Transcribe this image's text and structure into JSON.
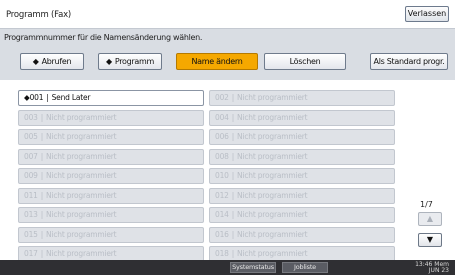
{
  "window": {
    "title": "Programm (Fax)",
    "exit_label": "Verlassen"
  },
  "instruction": "Programmnummer für die Namensänderung wählen.",
  "toolbar": {
    "recall_label": "Abrufen",
    "recall_icon": "◆",
    "program_label": "Programm",
    "program_icon": "◆",
    "rename_label": "Name ändern",
    "delete_label": "Löschen",
    "default_label": "Als Standard progr."
  },
  "slots_left": [
    {
      "num": "001",
      "label": "Send Later",
      "filled": true
    },
    {
      "num": "003",
      "label": "Nicht programmiert",
      "filled": false
    },
    {
      "num": "005",
      "label": "Nicht programmiert",
      "filled": false
    },
    {
      "num": "007",
      "label": "Nicht programmiert",
      "filled": false
    },
    {
      "num": "009",
      "label": "Nicht programmiert",
      "filled": false
    },
    {
      "num": "011",
      "label": "Nicht programmiert",
      "filled": false
    },
    {
      "num": "013",
      "label": "Nicht programmiert",
      "filled": false
    },
    {
      "num": "015",
      "label": "Nicht programmiert",
      "filled": false
    },
    {
      "num": "017",
      "label": "Nicht programmiert",
      "filled": false
    }
  ],
  "slots_right": [
    {
      "num": "002",
      "label": "Nicht programmiert",
      "filled": false
    },
    {
      "num": "004",
      "label": "Nicht programmiert",
      "filled": false
    },
    {
      "num": "006",
      "label": "Nicht programmiert",
      "filled": false
    },
    {
      "num": "008",
      "label": "Nicht programmiert",
      "filled": false
    },
    {
      "num": "010",
      "label": "Nicht programmiert",
      "filled": false
    },
    {
      "num": "012",
      "label": "Nicht programmiert",
      "filled": false
    },
    {
      "num": "014",
      "label": "Nicht programmiert",
      "filled": false
    },
    {
      "num": "016",
      "label": "Nicht programmiert",
      "filled": false
    },
    {
      "num": "018",
      "label": "Nicht programmiert",
      "filled": false
    }
  ],
  "pager": {
    "text": "1/7",
    "up_icon": "▲",
    "down_icon": "▼"
  },
  "statusbar": {
    "button1": "Systemstatus",
    "button2": "Jobliste",
    "time": "13:46",
    "date_line": "JUN",
    "mem": "Mem",
    "day": "23"
  },
  "colors": {
    "accent": "#f5a800",
    "panel": "#d9dde3",
    "statusbar": "#2f2f33"
  }
}
